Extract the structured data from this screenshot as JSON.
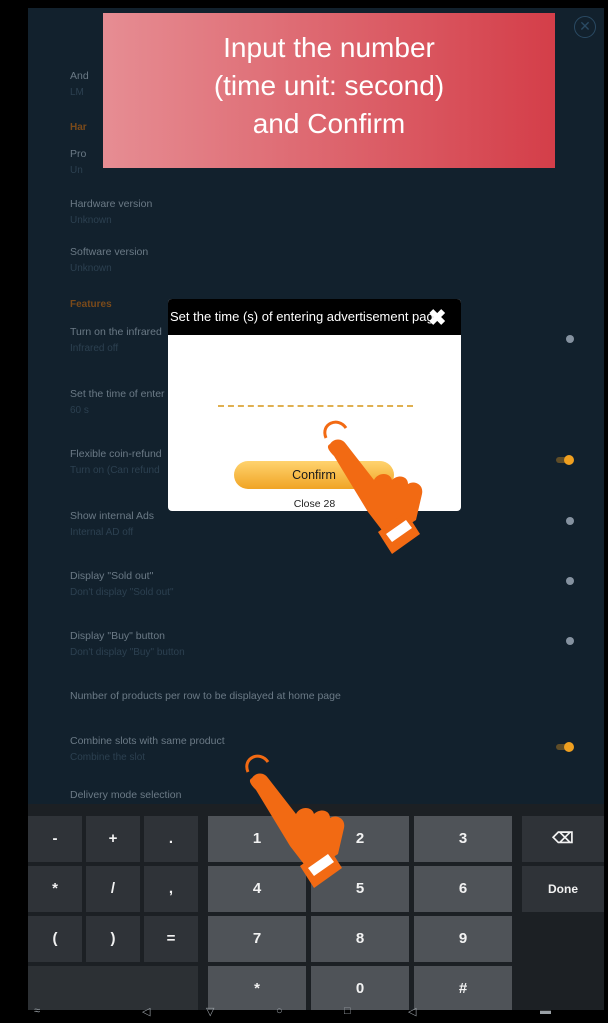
{
  "tooltip": {
    "line1": "Input the number",
    "line2": "(time unit: second)",
    "line3": "and Confirm"
  },
  "settings": {
    "android": {
      "title": "And",
      "sub": "LM"
    },
    "hardware_section": "Har",
    "product": {
      "title": "Pro",
      "sub": "Un"
    },
    "hardware_version": {
      "title": "Hardware version",
      "sub": "Unknown"
    },
    "software_version": {
      "title": "Software version",
      "sub": "Unknown"
    },
    "features_section": "Features",
    "infrared": {
      "title": "Turn on the infrared",
      "sub": "Infrared off"
    },
    "ad_time": {
      "title": "Set the time of enter",
      "sub": "60 s"
    },
    "coin_refund": {
      "title": "Flexible coin-refund",
      "sub": "Turn on (Can refund"
    },
    "internal_ads": {
      "title": "Show internal Ads",
      "sub": "Internal AD off"
    },
    "sold_out": {
      "title": "Display \"Sold out\"",
      "sub": "Don't display \"Sold out\""
    },
    "buy_button": {
      "title": "Display \"Buy\" button",
      "sub": "Don't display \"Buy\" button"
    },
    "products_per_row": {
      "title": "Number of products per row to be displayed at home page"
    },
    "combine_slots": {
      "title": "Combine slots with same product",
      "sub": "Combine the slot"
    },
    "delivery_mode": {
      "title": "Delivery mode selection"
    }
  },
  "dialog": {
    "title": "Set the time (s) of entering advertisement page",
    "confirm": "Confirm",
    "close": "Close 28"
  },
  "keyboard": {
    "minus": "-",
    "plus": "+",
    "dot": ".",
    "k1": "1",
    "k2": "2",
    "k3": "3",
    "star_left": "*",
    "slash": "/",
    "comma": ",",
    "k4": "4",
    "k5": "5",
    "k6": "6",
    "done": "Done",
    "lparen": "(",
    "rparen": ")",
    "equals": "=",
    "k7": "7",
    "k8": "8",
    "k9": "9",
    "star": "*",
    "k0": "0",
    "hash": "#"
  },
  "colors": {
    "accent": "#f0a425",
    "tooltip_start": "#e68d93",
    "tooltip_end": "#d43e49",
    "hand": "#f26a13"
  }
}
